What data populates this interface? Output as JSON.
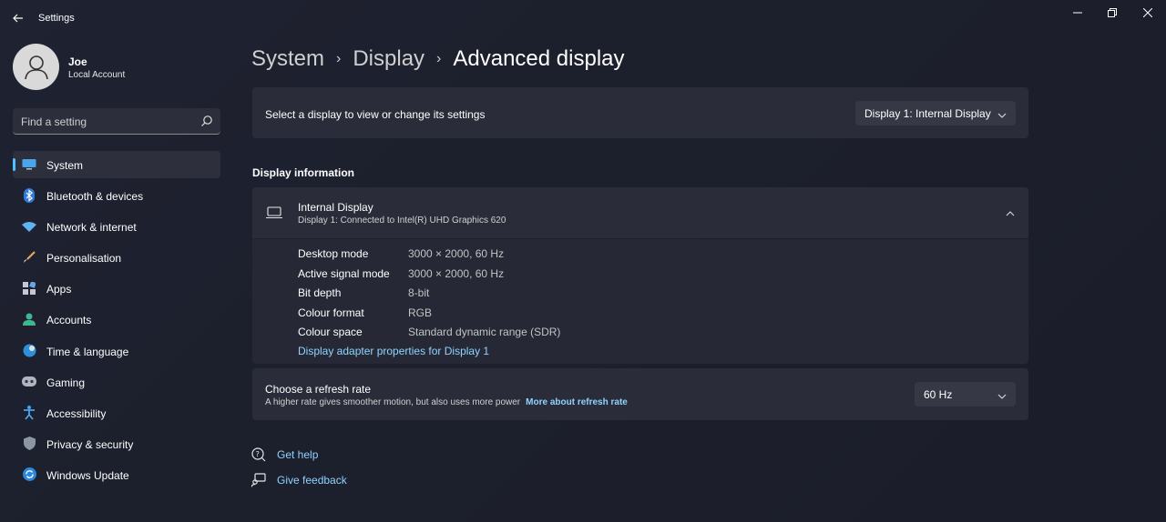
{
  "app": {
    "title": "Settings"
  },
  "profile": {
    "name": "Joe",
    "subtitle": "Local Account"
  },
  "search": {
    "placeholder": "Find a setting"
  },
  "sidebar": {
    "items": [
      {
        "label": "System",
        "icon": "monitor-icon",
        "active": true
      },
      {
        "label": "Bluetooth & devices",
        "icon": "bluetooth-icon"
      },
      {
        "label": "Network & internet",
        "icon": "wifi-icon"
      },
      {
        "label": "Personalisation",
        "icon": "brush-icon"
      },
      {
        "label": "Apps",
        "icon": "apps-icon"
      },
      {
        "label": "Accounts",
        "icon": "person-icon"
      },
      {
        "label": "Time & language",
        "icon": "globe-clock-icon"
      },
      {
        "label": "Gaming",
        "icon": "gamepad-icon"
      },
      {
        "label": "Accessibility",
        "icon": "accessibility-icon"
      },
      {
        "label": "Privacy & security",
        "icon": "shield-icon"
      },
      {
        "label": "Windows Update",
        "icon": "update-icon"
      }
    ]
  },
  "breadcrumb": {
    "level1": "System",
    "level2": "Display",
    "current": "Advanced display"
  },
  "display_select": {
    "label": "Select a display to view or change its settings",
    "selected": "Display 1: Internal Display"
  },
  "display_info": {
    "section_title": "Display information",
    "title": "Internal Display",
    "subtitle": "Display 1: Connected to Intel(R) UHD Graphics 620",
    "rows": [
      {
        "key": "Desktop mode",
        "value": "3000 × 2000, 60 Hz"
      },
      {
        "key": "Active signal mode",
        "value": "3000 × 2000, 60 Hz"
      },
      {
        "key": "Bit depth",
        "value": "8-bit"
      },
      {
        "key": "Colour format",
        "value": "RGB"
      },
      {
        "key": "Colour space",
        "value": "Standard dynamic range (SDR)"
      }
    ],
    "adapter_link": "Display adapter properties for Display 1"
  },
  "refresh": {
    "title": "Choose a refresh rate",
    "subtitle": "A higher rate gives smoother motion, but also uses more power",
    "link": "More about refresh rate",
    "selected": "60 Hz"
  },
  "help": {
    "get_help": "Get help",
    "feedback": "Give feedback"
  },
  "colors": {
    "accent": "#4cc2ff",
    "link": "#8fd3ff",
    "card": "#2a2d39"
  }
}
